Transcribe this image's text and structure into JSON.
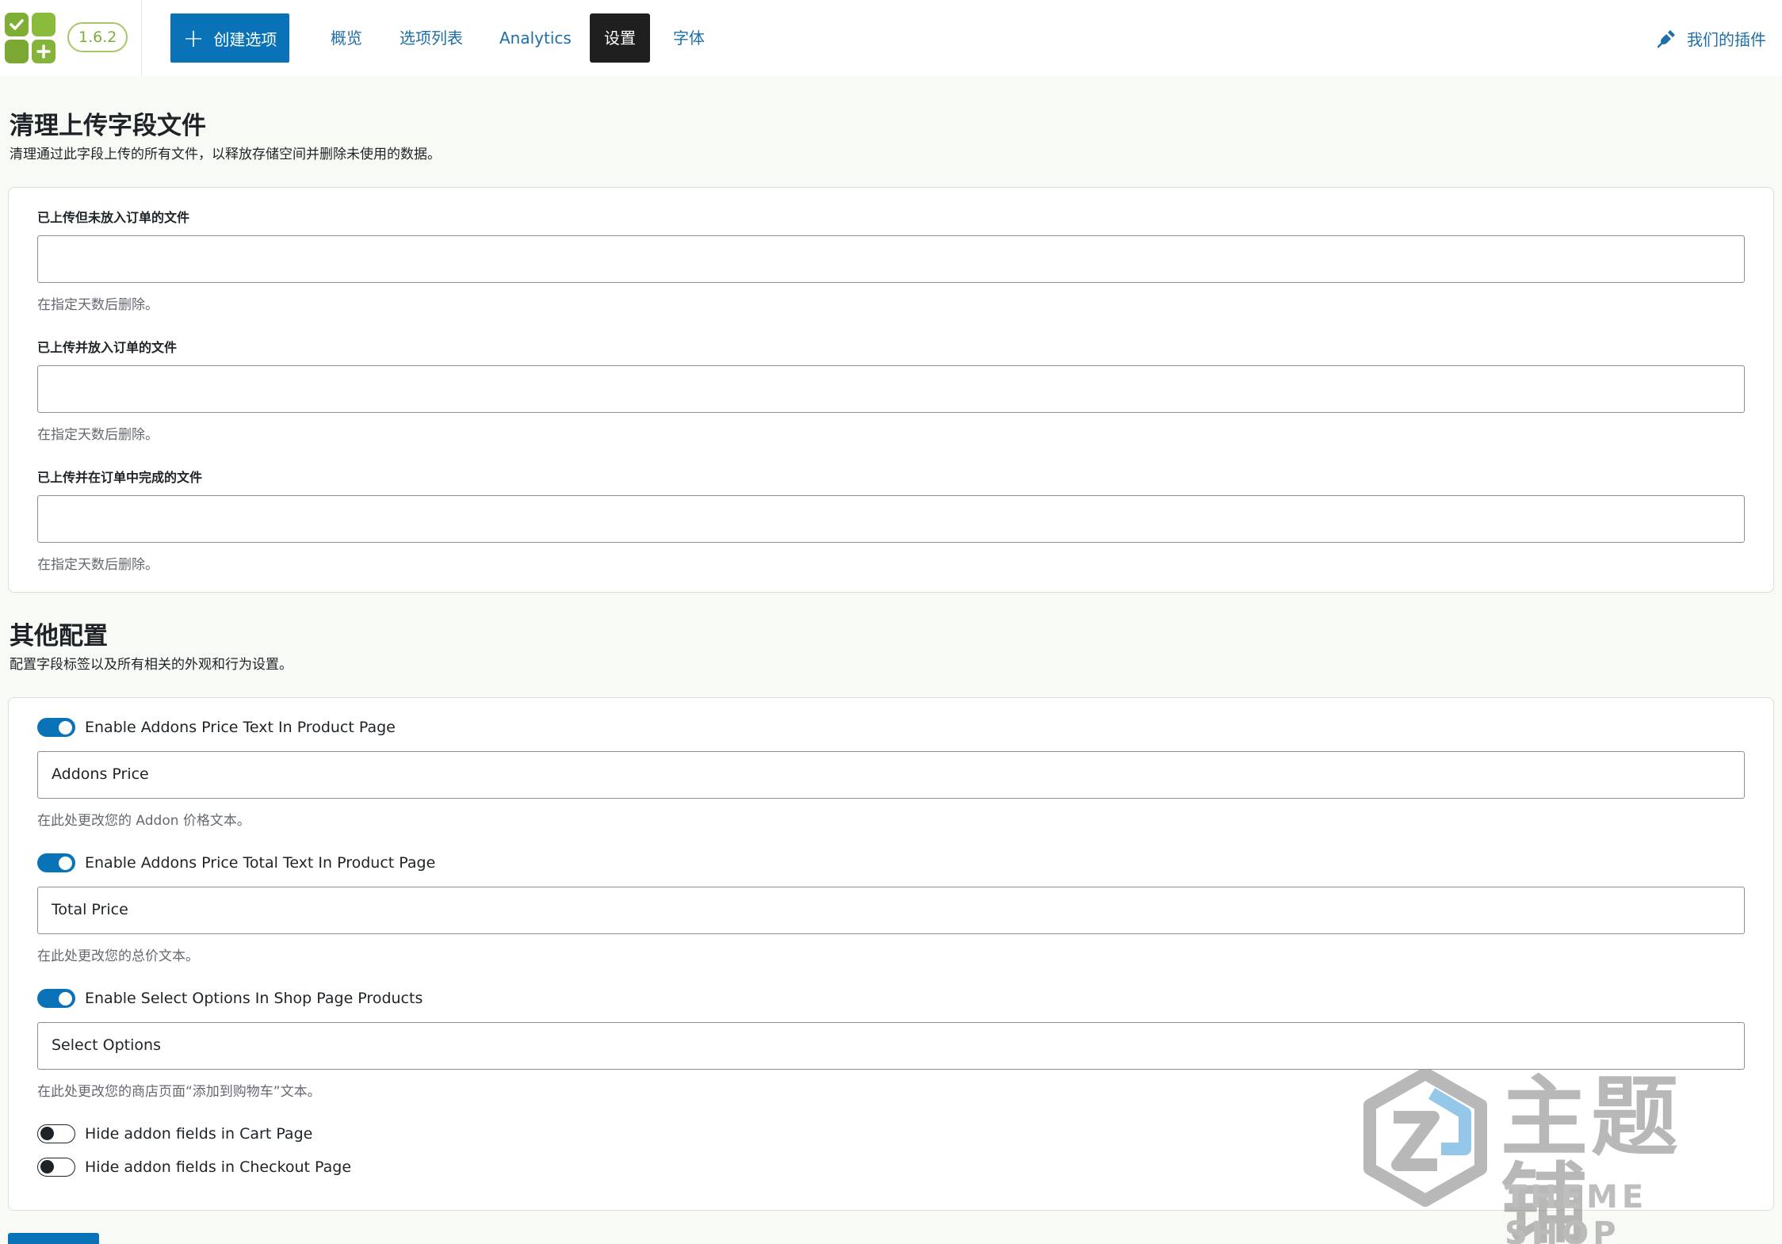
{
  "header": {
    "version": "1.6.2",
    "create_button_label": "创建选项",
    "tabs": [
      {
        "label": "概览",
        "active": false
      },
      {
        "label": "选项列表",
        "active": false
      },
      {
        "label": "Analytics",
        "active": false
      },
      {
        "label": "设置",
        "active": true
      },
      {
        "label": "字体",
        "active": false
      }
    ],
    "plugins_link_label": "我们的插件"
  },
  "cleanup_section": {
    "title": "清理上传字段文件",
    "description": "清理通过此字段上传的所有文件，以释放存储空间并删除未使用的数据。",
    "fields": [
      {
        "label": "已上传但未放入订单的文件",
        "value": "",
        "help": "在指定天数后删除。"
      },
      {
        "label": "已上传并放入订单的文件",
        "value": "",
        "help": "在指定天数后删除。"
      },
      {
        "label": "已上传并在订单中完成的文件",
        "value": "",
        "help": "在指定天数后删除。"
      }
    ]
  },
  "other_section": {
    "title": "其他配置",
    "description": "配置字段标签以及所有相关的外观和行为设置。",
    "options": [
      {
        "toggle_label": "Enable Addons Price Text In Product Page",
        "enabled": true,
        "value": "Addons Price",
        "help": "在此处更改您的 Addon 价格文本。"
      },
      {
        "toggle_label": "Enable Addons Price Total Text In Product Page",
        "enabled": true,
        "value": "Total Price",
        "help": "在此处更改您的总价文本。"
      },
      {
        "toggle_label": "Enable Select Options In Shop Page Products",
        "enabled": true,
        "value": "Select Options",
        "help": "在此处更改您的商店页面“添加到购物车”文本。"
      }
    ],
    "hide_toggles": [
      {
        "label": "Hide addon fields in Cart Page",
        "enabled": false
      },
      {
        "label": "Hide addon fields in Checkout Page",
        "enabled": false
      }
    ]
  },
  "watermark": {
    "text_cn": "主题铺",
    "text_en": "THEME SHOP"
  },
  "colors": {
    "primary": "#0a73b8",
    "logo_green": "#7fae35",
    "active_tab": "#1f1f1f",
    "link": "#1e6fa8"
  },
  "icons": {
    "logo": "app-logo",
    "plus": "plus-icon",
    "plugins": "plug-icon",
    "toggle_on": "toggle-on-icon",
    "toggle_off": "toggle-off-icon"
  }
}
